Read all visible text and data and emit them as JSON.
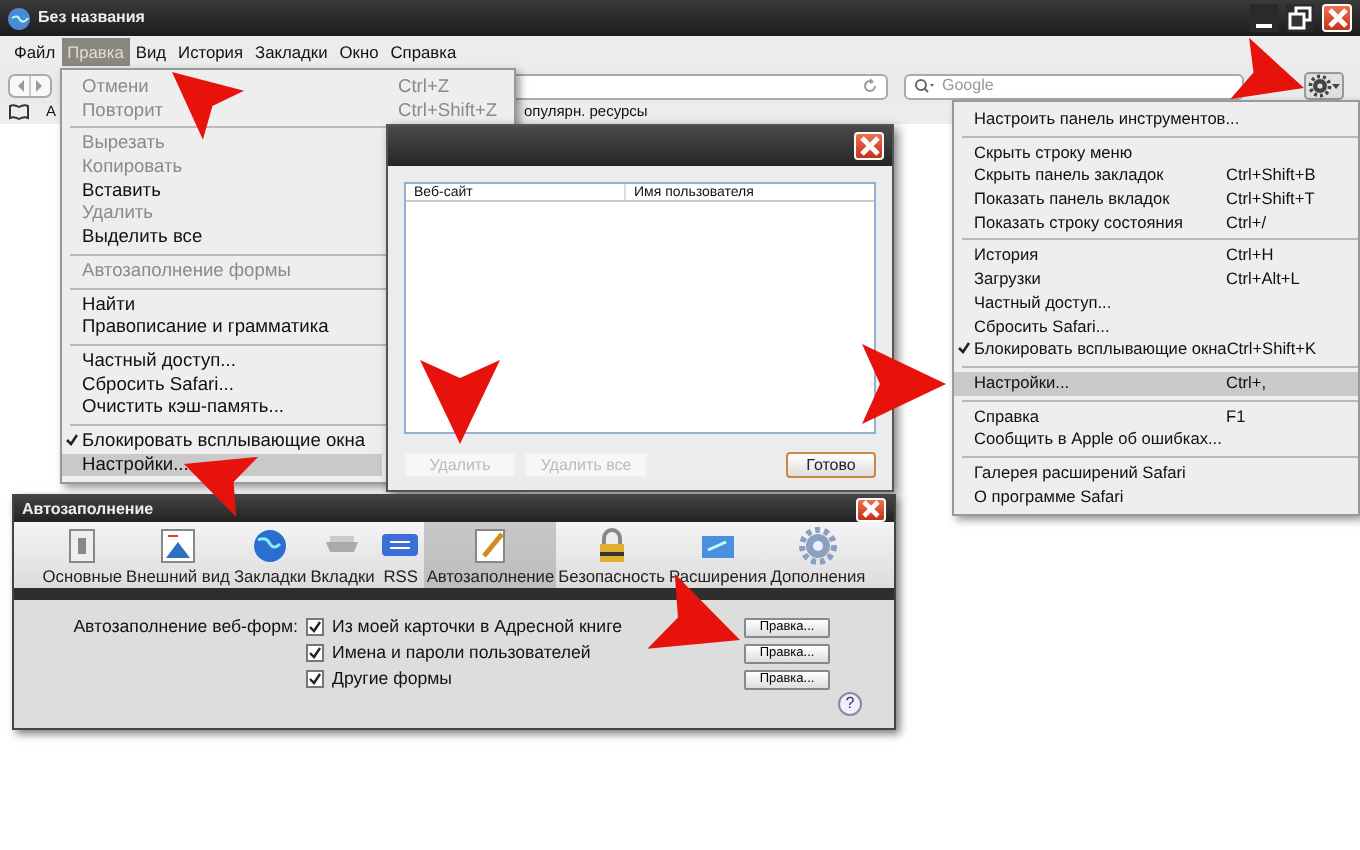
{
  "window": {
    "title": "Без названия"
  },
  "menu_bar": [
    {
      "label": "Файл",
      "selected": false
    },
    {
      "label": "Правка",
      "selected": true
    },
    {
      "label": "Вид",
      "selected": false
    },
    {
      "label": "История",
      "selected": false
    },
    {
      "label": "Закладки",
      "selected": false
    },
    {
      "label": "Окно",
      "selected": false
    },
    {
      "label": "Справка",
      "selected": false
    }
  ],
  "search": {
    "placeholder": "Google"
  },
  "bookmarks_bar": [
    "А",
    "опулярн. ресурсы"
  ],
  "edit_menu": [
    {
      "kind": "item",
      "label": "Отмени",
      "shortcut": "Ctrl+Z",
      "disabled": true,
      "checked": false,
      "selected": false
    },
    {
      "kind": "item",
      "label": "Повторит",
      "shortcut": "Ctrl+Shift+Z",
      "disabled": true,
      "checked": false,
      "selected": false
    },
    {
      "kind": "separator"
    },
    {
      "kind": "item",
      "label": "Вырезать",
      "disabled": true,
      "checked": false,
      "selected": false
    },
    {
      "kind": "item",
      "label": "Копировать",
      "disabled": true,
      "checked": false,
      "selected": false
    },
    {
      "kind": "item",
      "label": "Вставить",
      "disabled": false,
      "checked": false,
      "selected": false
    },
    {
      "kind": "item",
      "label": "Удалить",
      "disabled": true,
      "checked": false,
      "selected": false
    },
    {
      "kind": "item",
      "label": "Выделить все",
      "disabled": false,
      "checked": false,
      "selected": false
    },
    {
      "kind": "separator"
    },
    {
      "kind": "item",
      "label": "Автозаполнение формы",
      "disabled": true,
      "checked": false,
      "selected": false
    },
    {
      "kind": "separator"
    },
    {
      "kind": "item",
      "label": "Найти",
      "disabled": false,
      "checked": false,
      "selected": false
    },
    {
      "kind": "item",
      "label": "Правописание и грамматика",
      "disabled": false,
      "checked": false,
      "selected": false
    },
    {
      "kind": "separator"
    },
    {
      "kind": "item",
      "label": "Частный доступ...",
      "disabled": false,
      "checked": false,
      "selected": false
    },
    {
      "kind": "item",
      "label": "Сбросить Safari...",
      "disabled": false,
      "checked": false,
      "selected": false
    },
    {
      "kind": "item",
      "label": "Очистить кэш-память...",
      "disabled": false,
      "checked": false,
      "selected": false
    },
    {
      "kind": "separator"
    },
    {
      "kind": "item",
      "label": "Блокировать всплывающие окна",
      "disabled": false,
      "checked": true,
      "selected": false
    },
    {
      "kind": "item",
      "label": "Настройки...",
      "disabled": false,
      "checked": false,
      "selected": true
    }
  ],
  "passwords_dialog": {
    "columns": [
      "Веб-сайт",
      "Имя пользователя"
    ],
    "buttons": [
      {
        "label": "Удалить",
        "disabled": true
      },
      {
        "label": "Удалить все",
        "disabled": true
      },
      {
        "label": "Готово",
        "disabled": false
      }
    ]
  },
  "action_menu": [
    {
      "kind": "item",
      "label": "Настроить панель инструментов...",
      "disabled": false,
      "checked": false,
      "selected": false
    },
    {
      "kind": "separator"
    },
    {
      "kind": "item",
      "label": "Скрыть строку меню",
      "disabled": false,
      "checked": false,
      "selected": false
    },
    {
      "kind": "item",
      "label": "Скрыть панель закладок",
      "shortcut": "Ctrl+Shift+B",
      "disabled": false,
      "checked": false,
      "selected": false
    },
    {
      "kind": "item",
      "label": "Показать панель вкладок",
      "shortcut": "Ctrl+Shift+T",
      "disabled": false,
      "checked": false,
      "selected": false
    },
    {
      "kind": "item",
      "label": "Показать строку состояния",
      "shortcut": "Ctrl+/",
      "disabled": false,
      "checked": false,
      "selected": false
    },
    {
      "kind": "separator"
    },
    {
      "kind": "item",
      "label": "История",
      "shortcut": "Ctrl+H",
      "disabled": false,
      "checked": false,
      "selected": false
    },
    {
      "kind": "item",
      "label": "Загрузки",
      "shortcut": "Ctrl+Alt+L",
      "disabled": false,
      "checked": false,
      "selected": false
    },
    {
      "kind": "item",
      "label": "Частный доступ...",
      "disabled": false,
      "checked": false,
      "selected": false
    },
    {
      "kind": "item",
      "label": "Сбросить Safari...",
      "disabled": false,
      "checked": false,
      "selected": false
    },
    {
      "kind": "item",
      "label": "Блокировать всплывающие окна",
      "shortcut": "Ctrl+Shift+K",
      "disabled": false,
      "checked": true,
      "selected": false
    },
    {
      "kind": "separator"
    },
    {
      "kind": "item",
      "label": "Настройки...",
      "shortcut": "Ctrl+,",
      "disabled": false,
      "checked": false,
      "selected": true
    },
    {
      "kind": "separator"
    },
    {
      "kind": "item",
      "label": "Справка",
      "shortcut": "F1",
      "disabled": false,
      "checked": false,
      "selected": false
    },
    {
      "kind": "item",
      "label": "Сообщить в Apple об ошибках...",
      "disabled": false,
      "checked": false,
      "selected": false
    },
    {
      "kind": "separator"
    },
    {
      "kind": "item",
      "label": "Галерея расширений Safari",
      "disabled": false,
      "checked": false,
      "selected": false
    },
    {
      "kind": "item",
      "label": "О программе Safari",
      "disabled": false,
      "checked": false,
      "selected": false
    }
  ],
  "preferences": {
    "title": "Автозаполнение",
    "tabs": [
      {
        "label": "Основные",
        "selected": false
      },
      {
        "label": "Внешний вид",
        "selected": false
      },
      {
        "label": "Закладки",
        "selected": false
      },
      {
        "label": "Вкладки",
        "selected": false
      },
      {
        "label": "RSS",
        "selected": false
      },
      {
        "label": "Автозаполнение",
        "selected": true
      },
      {
        "label": "Безопасность",
        "selected": false
      },
      {
        "label": "Расширения",
        "selected": false
      },
      {
        "label": "Дополнения",
        "selected": false
      }
    ],
    "form_label": "Автозаполнение веб-форм:",
    "options": [
      {
        "label": "Из моей карточки в Адресной книге",
        "checked": true,
        "button": "Правка..."
      },
      {
        "label": "Имена и пароли пользователей",
        "checked": true,
        "button": "Правка..."
      },
      {
        "label": "Другие формы",
        "checked": true,
        "button": "Правка..."
      }
    ],
    "help": "?"
  }
}
